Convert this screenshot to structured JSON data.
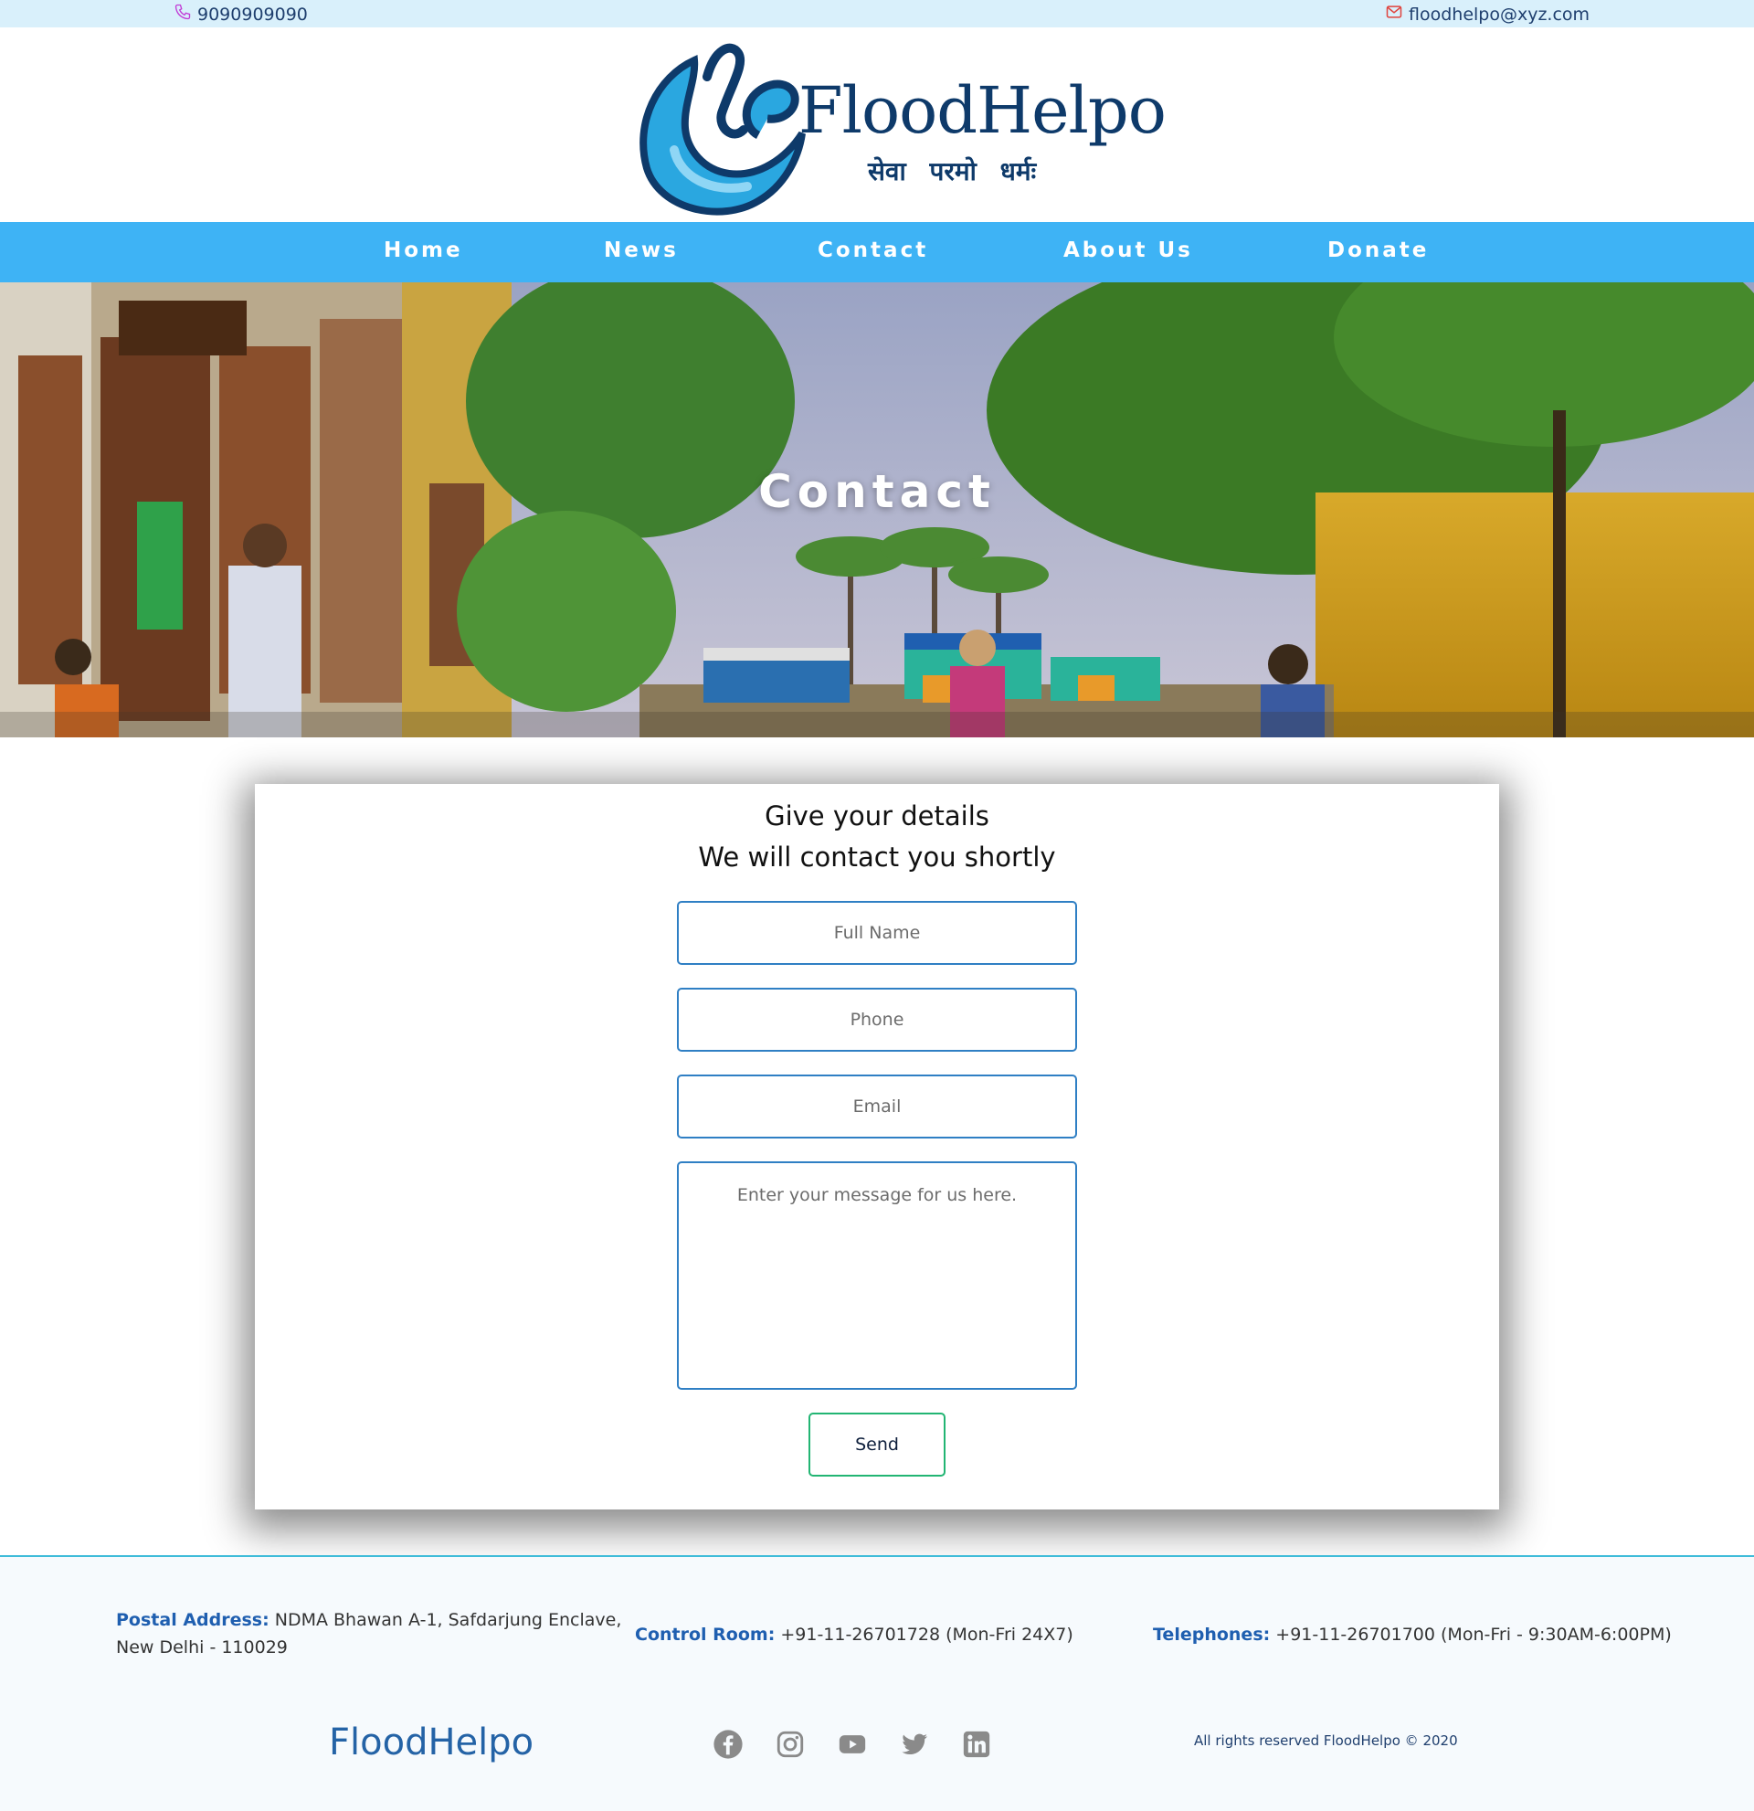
{
  "topbar": {
    "phone": "9090909090",
    "email": "floodhelpo@xyz.com"
  },
  "logo": {
    "title": "FloodHelpo",
    "tagline": "सेवा परमो धर्मः"
  },
  "nav": {
    "items": [
      "Home",
      "News",
      "Contact",
      "About Us",
      "Donate"
    ]
  },
  "hero": {
    "title": "Contact"
  },
  "form": {
    "heading_line1": "Give your details",
    "heading_line2": "We will contact you shortly",
    "full_name_placeholder": "Full Name",
    "phone_placeholder": "Phone",
    "email_placeholder": "Email",
    "message_placeholder": "Enter your message for us here.",
    "send_label": "Send"
  },
  "footer": {
    "postal_label": "Postal Address:",
    "postal_value_line1": "NDMA Bhawan A-1, Safdarjung Enclave,",
    "postal_value_line2": "New Delhi - 110029",
    "control_label": "Control Room:",
    "control_value": "+91-11-26701728 (Mon-Fri 24X7)",
    "telephone_label": "Telephones:",
    "telephone_value": "+91-11-26701700 (Mon-Fri - 9:30AM-6:00PM)",
    "brand": "FloodHelpo",
    "copyright": "All rights reserved FloodHelpo © 2020",
    "socials": [
      "facebook-icon",
      "instagram-icon",
      "youtube-icon",
      "twitter-icon",
      "linkedin-icon"
    ]
  },
  "colors": {
    "topbar_bg": "#d9f0fb",
    "nav_bg": "#3eb3f5",
    "brand_dark": "#0e3a6a",
    "input_border": "#2f7fc4",
    "send_border": "#22b573"
  }
}
